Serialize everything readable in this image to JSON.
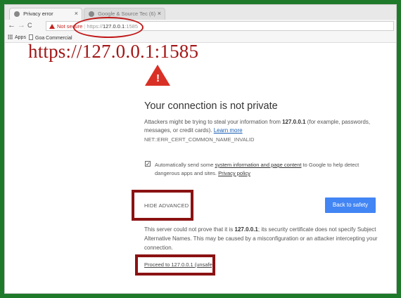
{
  "tabs": [
    {
      "label": "Privacy error",
      "close": "×"
    },
    {
      "label": "Google & Source Tec (6)",
      "close": "×"
    }
  ],
  "toolbar": {
    "back": "←",
    "forward": "→",
    "reload": "C",
    "not_secure": "Not secure",
    "url_scheme": "https://",
    "url_host": "127.0.0.1",
    "url_port": ":1585"
  },
  "bookmarks": {
    "apps": "Apps",
    "item1": "Goa Commercial"
  },
  "annotation": {
    "big_url": "https://127.0.0.1:1585"
  },
  "interstitial": {
    "headline": "Your connection is not private",
    "desc_part1": "Attackers might be trying to steal your information from ",
    "desc_host": "127.0.0.1",
    "desc_part2": " (for example, passwords, messages, or credit cards). ",
    "learn_more": "Learn more",
    "error_code": "NET::ERR_CERT_COMMON_NAME_INVALID",
    "checkbox_mark": "✓",
    "report_part1": "Automatically send some ",
    "report_link": "system information and page content",
    "report_part2": " to Google to help detect dangerous apps and sites. ",
    "privacy_policy": "Privacy policy",
    "hide_advanced": "HIDE ADVANCED",
    "back_to_safety": "Back to safety",
    "details_part1": "This server could not prove that it is ",
    "details_host": "127.0.0.1",
    "details_part2": "; its security certificate does not specify Subject Alternative Names. This may be caused by a misconfiguration or an attacker intercepting your connection.",
    "proceed": "Proceed to 127.0.0.1 (unsafe)"
  },
  "colors": {
    "frame": "#1e7a2a",
    "annotation_red": "#a31616",
    "button_blue": "#4285f4",
    "warning_red": "#d93025"
  }
}
